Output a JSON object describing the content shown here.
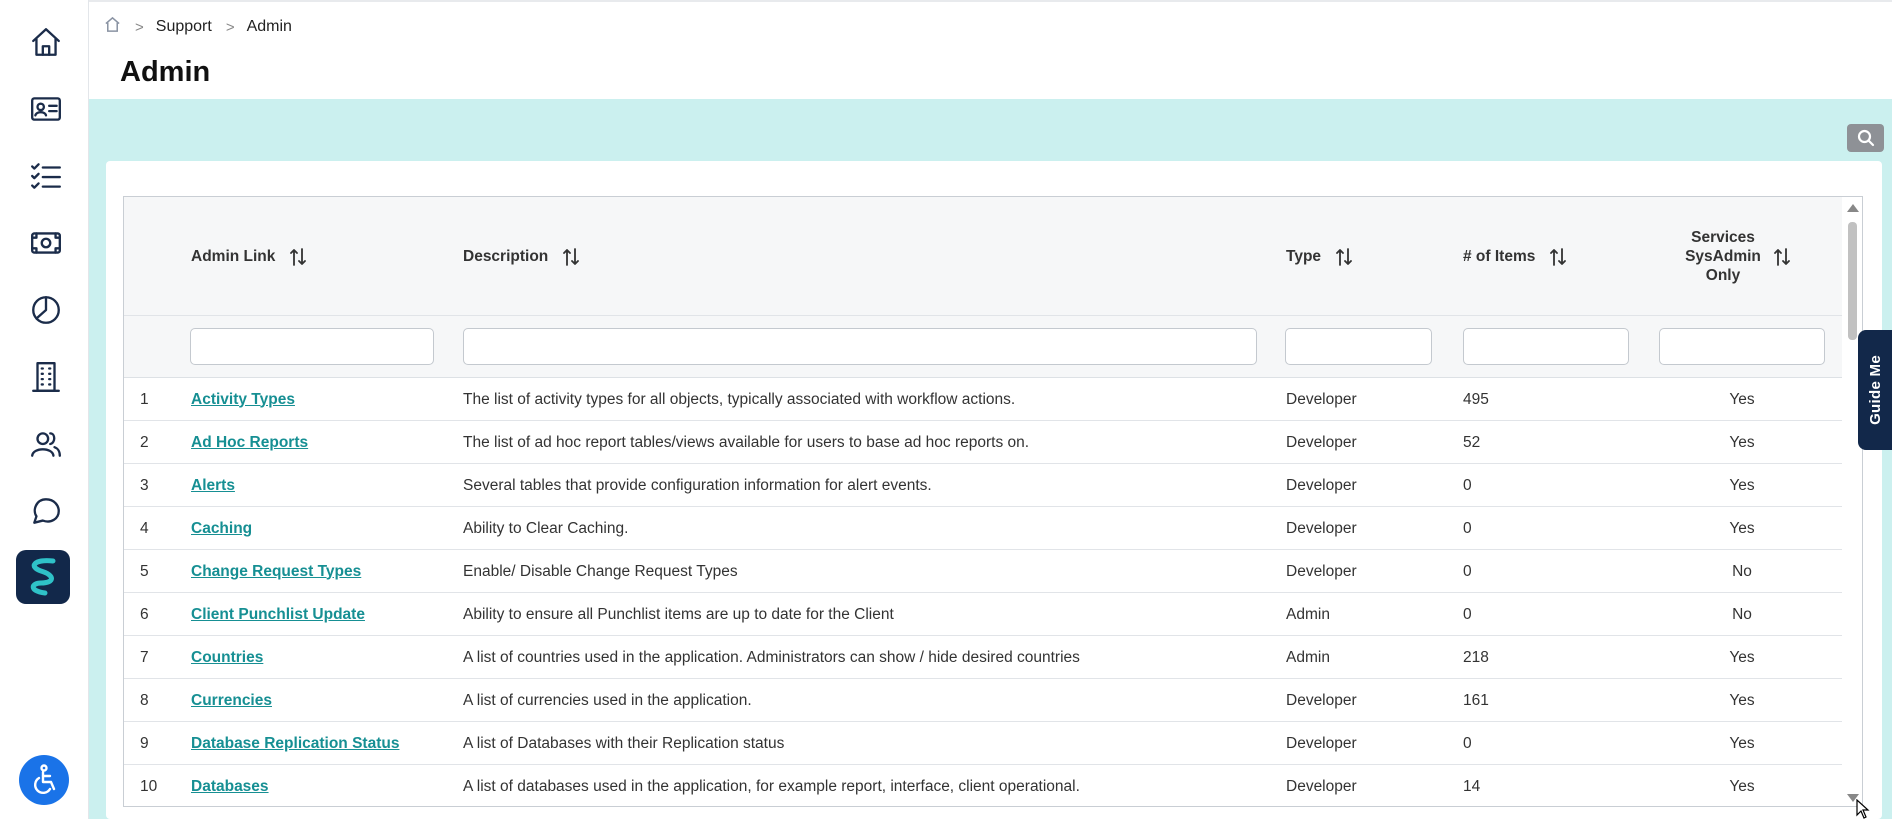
{
  "breadcrumb": {
    "items": [
      "Support",
      "Admin"
    ],
    "separator": ">"
  },
  "page": {
    "title": "Admin"
  },
  "sidebar": {
    "items": [
      {
        "icon": "home-icon"
      },
      {
        "icon": "contact-card-icon"
      },
      {
        "icon": "checklist-icon"
      },
      {
        "icon": "money-icon"
      },
      {
        "icon": "pie-chart-icon"
      },
      {
        "icon": "building-icon"
      },
      {
        "icon": "people-icon"
      },
      {
        "icon": "chat-icon"
      },
      {
        "icon": "brand-logo-icon"
      }
    ],
    "accessibility_icon": "accessibility-icon"
  },
  "colors": {
    "accent": "#168f93",
    "band": "#cbf0ef",
    "navy": "#12284a",
    "accessibility": "#1a73e8"
  },
  "table": {
    "columns": [
      {
        "label": "Admin Link"
      },
      {
        "label": "Description"
      },
      {
        "label": "Type"
      },
      {
        "label": "# of Items"
      },
      {
        "label": "Services SysAdmin Only"
      }
    ],
    "rows": [
      {
        "num": "1",
        "link": "Activity Types",
        "description": "The list of activity types for all objects, typically associated with workflow actions.",
        "type": "Developer",
        "items": "495",
        "sysadmin": "Yes"
      },
      {
        "num": "2",
        "link": "Ad Hoc Reports",
        "description": "The list of ad hoc report tables/views available for users to base ad hoc reports on.",
        "type": "Developer",
        "items": "52",
        "sysadmin": "Yes"
      },
      {
        "num": "3",
        "link": "Alerts",
        "description": "Several tables that provide configuration information for alert events.",
        "type": "Developer",
        "items": "0",
        "sysadmin": "Yes"
      },
      {
        "num": "4",
        "link": "Caching",
        "description": "Ability to Clear Caching.",
        "type": "Developer",
        "items": "0",
        "sysadmin": "Yes"
      },
      {
        "num": "5",
        "link": "Change Request Types",
        "description": "Enable/ Disable Change Request Types",
        "type": "Developer",
        "items": "0",
        "sysadmin": "No"
      },
      {
        "num": "6",
        "link": "Client Punchlist Update",
        "description": "Ability to ensure all Punchlist items are up to date for the Client",
        "type": "Admin",
        "items": "0",
        "sysadmin": "No"
      },
      {
        "num": "7",
        "link": "Countries",
        "description": "A list of countries used in the application. Administrators can show / hide desired countries",
        "type": "Admin",
        "items": "218",
        "sysadmin": "Yes"
      },
      {
        "num": "8",
        "link": "Currencies",
        "description": "A list of currencies used in the application.",
        "type": "Developer",
        "items": "161",
        "sysadmin": "Yes"
      },
      {
        "num": "9",
        "link": "Database Replication Status",
        "description": "A list of Databases with their Replication status",
        "type": "Developer",
        "items": "0",
        "sysadmin": "Yes"
      },
      {
        "num": "10",
        "link": "Databases",
        "description": "A list of databases used in the application, for example report, interface, client operational.",
        "type": "Developer",
        "items": "14",
        "sysadmin": "Yes"
      }
    ]
  },
  "guide": {
    "label": "Guide Me"
  }
}
